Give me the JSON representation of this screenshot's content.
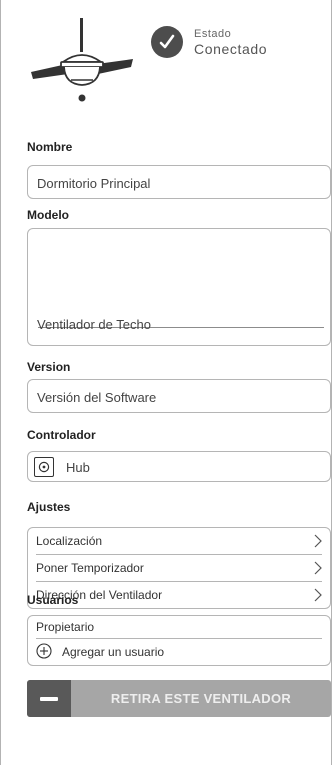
{
  "status": {
    "label": "Estado",
    "value": "Conectado"
  },
  "name": {
    "heading": "Nombre",
    "value": "Dormitorio Principal"
  },
  "model": {
    "heading": "Modelo",
    "value": "Ventilador de Techo"
  },
  "version": {
    "heading": "Version",
    "value": "Versión del Software"
  },
  "controller": {
    "heading": "Controlador",
    "value": "Hub"
  },
  "settings": {
    "heading": "Ajustes",
    "items": [
      {
        "label": "Localización"
      },
      {
        "label": "Poner Temporizador"
      },
      {
        "label": "Dirección del Ventilador"
      }
    ]
  },
  "users": {
    "heading": "Usuarios",
    "items": [
      {
        "label": "Propietario"
      }
    ],
    "add_label": "Agregar un usuario"
  },
  "remove_button": {
    "label": "RETIRA ESTE VENTILADOR"
  },
  "icons": {
    "device": "ceiling-fan-icon",
    "status": "check-icon",
    "controller": "hub-icon",
    "chevron": "chevron-right-icon",
    "add": "plus-circle-icon",
    "remove": "minus-icon"
  },
  "colors": {
    "status_badge": "#4d4d4d",
    "border": "#b5b5b5",
    "button": "#a6a6a6",
    "button_icon_bg": "#595959"
  }
}
